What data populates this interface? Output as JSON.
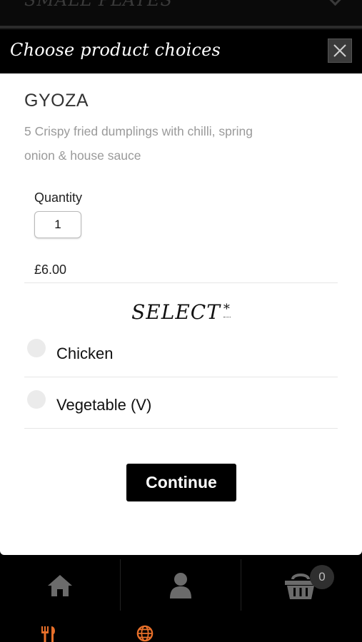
{
  "background": {
    "category_title": "SMALL PLATES"
  },
  "modal": {
    "title": "Choose product choices",
    "close_label": "×",
    "product": {
      "name": "GYOZA",
      "description_line1": "5 Crispy fried dumplings with chilli, spring",
      "description_line2": "onion & house sauce"
    },
    "quantity": {
      "label": "Quantity",
      "value": "1"
    },
    "price": "£6.00",
    "select": {
      "heading": "SELECT",
      "required_marker": "*",
      "options": [
        {
          "label": "Chicken",
          "selected": false
        },
        {
          "label": "Vegetable (V)",
          "selected": false
        }
      ]
    },
    "continue_label": "Continue"
  },
  "bottom_nav": {
    "cart_count": "0",
    "icons": [
      "home-icon",
      "user-icon",
      "cart-icon",
      "menu-icon",
      "globe-icon"
    ],
    "accent_color": "#e8702a",
    "icon_color": "#6b6b6b"
  }
}
